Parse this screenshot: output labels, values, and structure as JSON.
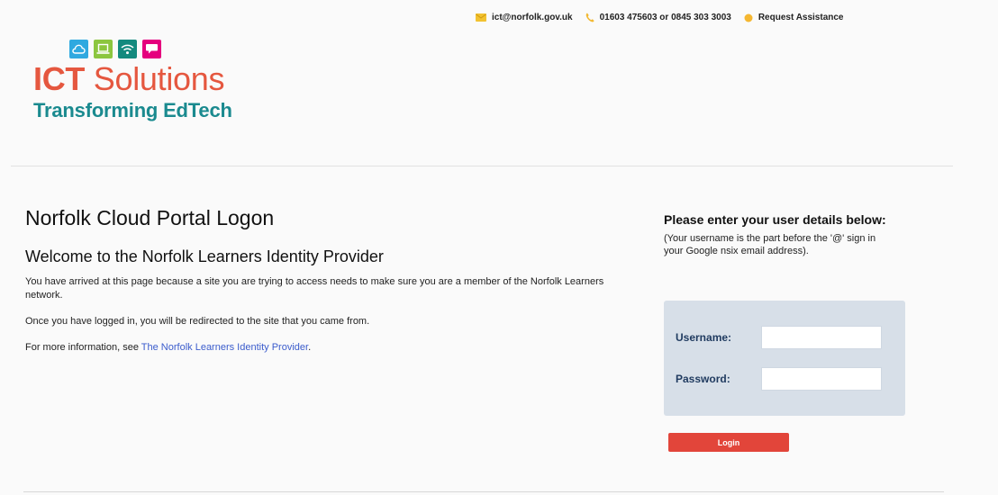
{
  "header": {
    "email": "ict@norfolk.gov.uk",
    "phone": "01603 475603 or 0845 303 3003",
    "assist": "Request Assistance",
    "icons": [
      "envelope-icon",
      "phone-icon",
      "dot-icon"
    ]
  },
  "logo": {
    "title_bold": "ICT",
    "title_rest": "Solutions",
    "subtitle": "Transforming EdTech",
    "tile_colors": [
      "#2fa9e0",
      "#8cc63f",
      "#138a7e",
      "#e5007e"
    ],
    "tile_icons": [
      "cloud-icon",
      "laptop-icon",
      "wifi-icon",
      "speech-bubble-icon"
    ]
  },
  "main": {
    "title": "Norfolk Cloud Portal Logon",
    "welcome": "Welcome to the Norfolk Learners Identity Provider",
    "p1": "You have arrived at this page because a site you are trying to access needs to make sure you are a member of the Norfolk Learners network.",
    "p2": "Once you have logged in, you will be redirected to the site that you came from.",
    "p3_prefix": "For more information, see ",
    "p3_link": "The Norfolk Learners Identity Provider",
    "p3_suffix": "."
  },
  "side": {
    "heading": "Please enter your user details below:",
    "hint": "(Your username is the part before the '@' sign in your Google nsix email address)."
  },
  "form": {
    "username_label": "Username:",
    "username_value": "",
    "password_label": "Password:",
    "password_value": "",
    "login_label": "Login"
  },
  "colors": {
    "brand_red": "#e5573f",
    "brand_teal": "#1a8a8f",
    "login_button": "#e2453a",
    "form_background": "#d7dfe8",
    "link": "#3b5ccc"
  }
}
